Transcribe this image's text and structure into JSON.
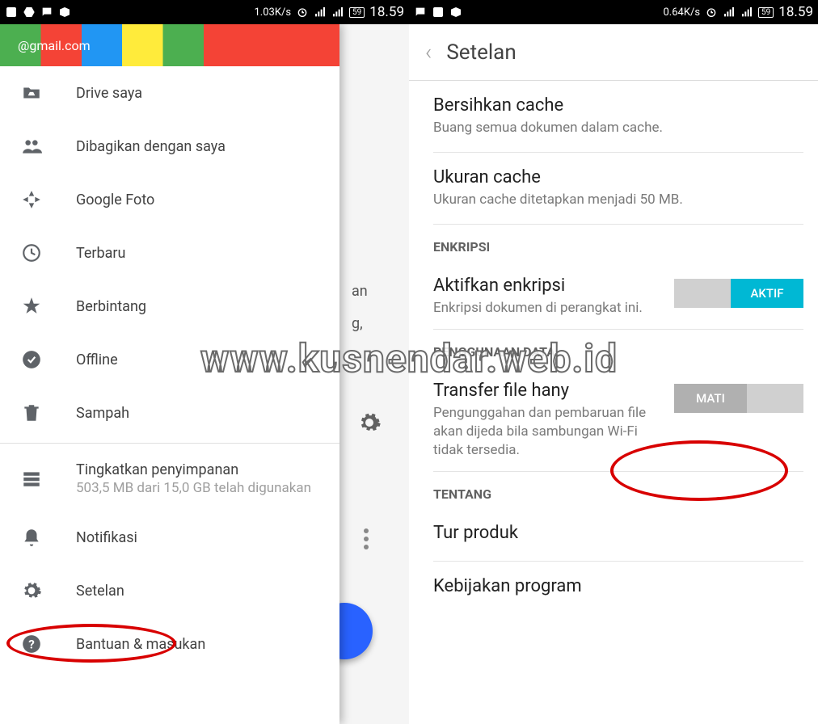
{
  "leftPhone": {
    "status": {
      "speed": "1.03K/s",
      "time": "18.59",
      "battery": "59"
    },
    "drawer": {
      "email": "@gmail.com",
      "items": [
        {
          "icon": "drive",
          "label": "Drive saya"
        },
        {
          "icon": "people",
          "label": "Dibagikan dengan saya"
        },
        {
          "icon": "photos",
          "label": "Google Foto"
        },
        {
          "icon": "clock",
          "label": "Terbaru"
        },
        {
          "icon": "star",
          "label": "Berbintang"
        },
        {
          "icon": "check",
          "label": "Offline"
        },
        {
          "icon": "trash",
          "label": "Sampah"
        }
      ],
      "storage": {
        "title": "Tingkatkan penyimpanan",
        "sub": "503,5 MB dari 15,0 GB telah digunakan"
      },
      "bottomItems": [
        {
          "icon": "bell",
          "label": "Notifikasi"
        },
        {
          "icon": "gear",
          "label": "Setelan"
        },
        {
          "icon": "help",
          "label": "Bantuan & masukan"
        }
      ]
    },
    "peekText": {
      "l1": "an",
      "l2": "g,"
    }
  },
  "rightPhone": {
    "status": {
      "speed": "0.64K/s",
      "time": "18.59",
      "battery": "59"
    },
    "header": "Setelan",
    "items": {
      "clearCache": {
        "t": "Bersihkan cache",
        "s": "Buang semua dokumen dalam cache."
      },
      "cacheSize": {
        "t": "Ukuran cache",
        "s": "Ukuran cache ditetapkan menjadi 50 MB."
      },
      "sect1": "ENKRIPSI",
      "encrypt": {
        "t": "Aktifkan enkripsi",
        "s": "Enkripsi dokumen di perangkat ini.",
        "toggle": "AKTIF"
      },
      "sect2": "PENGGUNAAN DATA",
      "wifi": {
        "t": "Transfer file hany",
        "s": "Pengunggahan dan pembaruan file akan dijeda bila sambungan Wi-Fi tidak tersedia.",
        "toggle": "MATI"
      },
      "sect3": "TENTANG",
      "tour": {
        "t": "Tur produk"
      },
      "policy": {
        "t": "Kebijakan program"
      }
    }
  },
  "watermark": "www.kusnendar.web.id"
}
